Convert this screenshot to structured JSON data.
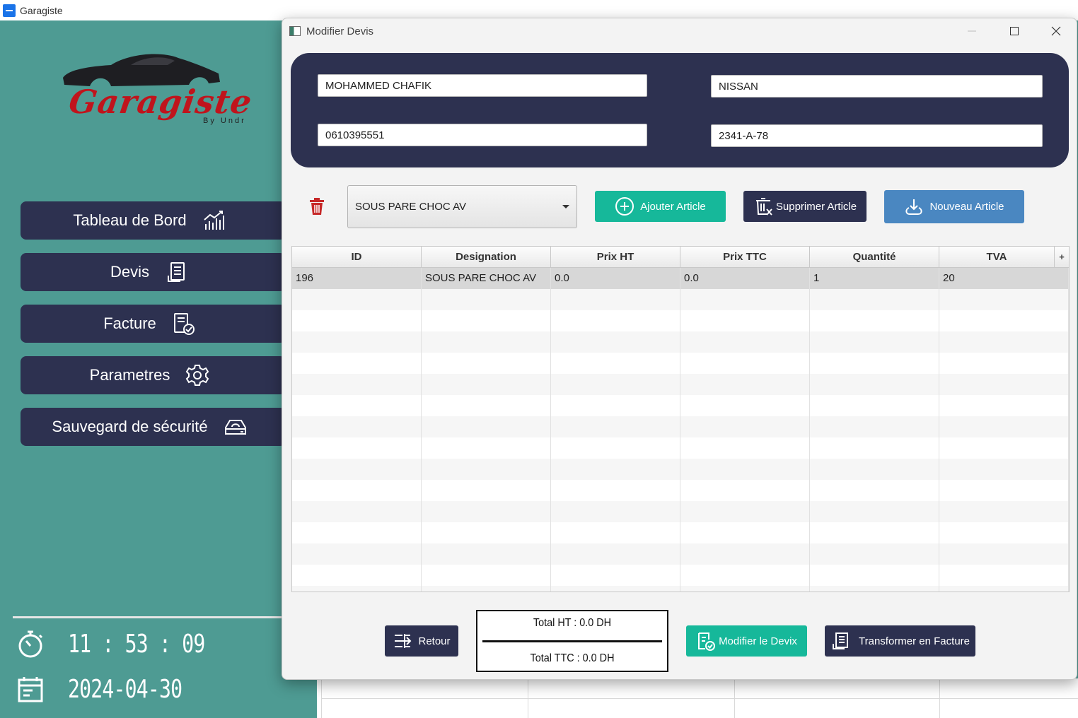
{
  "app": {
    "title": "Garagiste"
  },
  "logo": {
    "brand": "Garagiste",
    "sub": "By Undr"
  },
  "sidebar": {
    "items": [
      {
        "label": "Tableau de Bord",
        "icon": "chart-icon"
      },
      {
        "label": "Devis",
        "icon": "document-icon"
      },
      {
        "label": "Facture",
        "icon": "invoice-check-icon"
      },
      {
        "label": "Parametres",
        "icon": "gear-icon"
      },
      {
        "label": "Sauvegard de sécurité",
        "icon": "backup-drive-icon"
      }
    ],
    "time": "11 : 53 : 09",
    "date": "2024-04-30"
  },
  "dialog": {
    "title": "Modifier Devis",
    "client_name": "MOHAMMED CHAFIK",
    "phone": "0610395551",
    "car_brand": "NISSAN",
    "plate": "2341-A-78",
    "article_select": "SOUS PARE CHOC AV",
    "buttons": {
      "add": "Ajouter Article",
      "delete": "Supprimer Article",
      "new": "Nouveau Article",
      "back": "Retour",
      "modify": "Modifier le Devix",
      "transform": "Transformer en Facture"
    },
    "table": {
      "columns": [
        "ID",
        "Designation",
        "Prix HT",
        "Prix TTC",
        "Quantité",
        "TVA"
      ],
      "plus": "+",
      "rows": [
        [
          "196",
          "SOUS PARE CHOC AV",
          "0.0",
          "0.0",
          "1",
          "20"
        ]
      ]
    },
    "totals": {
      "ht": "Total HT : 0.0 DH",
      "ttc": "Total TTC : 0.0 DH"
    }
  },
  "colors": {
    "background": "#4e9b93",
    "navy": "#2d3150",
    "teal_button": "#16b89a",
    "blue_button": "#4a87c1",
    "logo_red": "#c0141c"
  }
}
